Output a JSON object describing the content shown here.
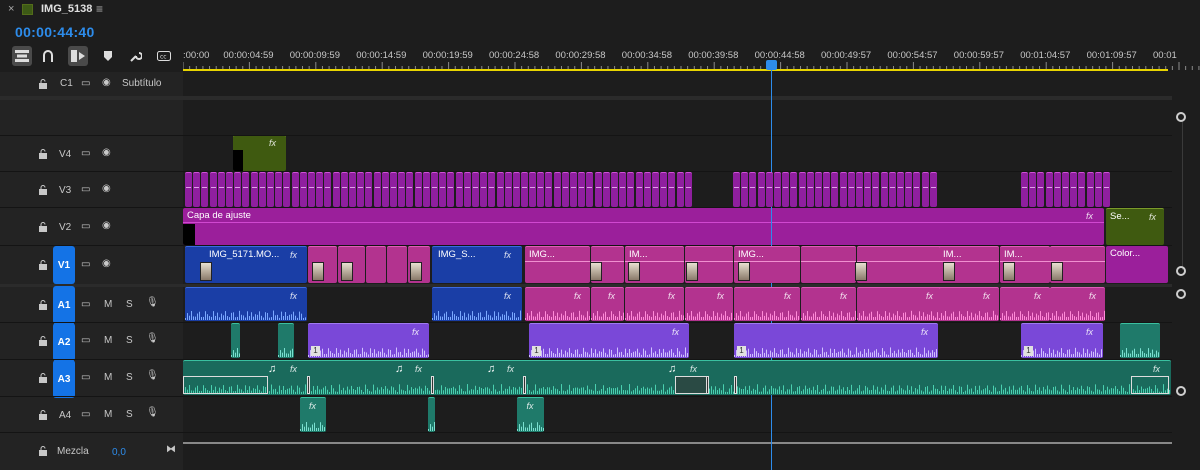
{
  "tab": {
    "close": "×",
    "title": "IMG_5138",
    "menu": "≡",
    "swatch_color": "#3d5a16"
  },
  "timecode": "00:00:44:40",
  "toolbar": [
    {
      "icon": "nest-icon",
      "glyph": "⇶",
      "active": true
    },
    {
      "icon": "snap-icon",
      "glyph": "∩",
      "active": false
    },
    {
      "icon": "linked-selection-icon",
      "glyph": "⊳",
      "active": true
    },
    {
      "icon": "marker-icon",
      "glyph": "⬟",
      "active": false
    },
    {
      "icon": "wrench-icon",
      "glyph": "🔧",
      "active": false
    },
    {
      "icon": "captions-icon",
      "glyph": "CC",
      "active": false
    }
  ],
  "ruler": {
    "labels": [
      ":00:00",
      "00:00:04:59",
      "00:00:09:59",
      "00:00:14:59",
      "00:00:19:59",
      "00:00:24:58",
      "00:00:29:58",
      "00:00:34:58",
      "00:00:39:58",
      "00:00:44:58",
      "00:00:49:57",
      "00:00:54:57",
      "00:00:59:57",
      "00:01:04:57",
      "00:01:09:57",
      "00:01"
    ]
  },
  "caption_track": {
    "name": "C1",
    "label": "Subtítulo"
  },
  "video_tracks": [
    {
      "name": "V4",
      "active": false
    },
    {
      "name": "V3",
      "active": false
    },
    {
      "name": "V2",
      "active": false
    },
    {
      "name": "V1",
      "active": true
    }
  ],
  "audio_tracks": [
    {
      "name": "A1",
      "m": "M",
      "s": "S"
    },
    {
      "name": "A2",
      "m": "M",
      "s": "S"
    },
    {
      "name": "A3",
      "m": "M",
      "s": "S"
    },
    {
      "name": "A4",
      "m": "M",
      "s": "S"
    }
  ],
  "mix": {
    "label": "Mezcla",
    "value": "0,0"
  },
  "clips": {
    "adjustment_label": "Capa de ajuste",
    "v1_labels": [
      "IMG_5171.MO...",
      "IMG_S...",
      "IMG...",
      "IM...",
      "IMG...",
      "IM...",
      "IM..."
    ],
    "v2_end_label": "Se...",
    "v1_end_label": "Color...",
    "fx": "fx",
    "a2_badge": "1"
  },
  "colors": {
    "accent_blue": "#2d8ceb",
    "v3_purple": "#8a24a6",
    "v1_magenta": "#b3338f",
    "v1_blue": "#1a3ea6",
    "a2_violet": "#7a48d8",
    "a3_teal": "#1f7a6a",
    "v4_green": "#3f5a10",
    "ruler_yellow": "#e8d400"
  }
}
